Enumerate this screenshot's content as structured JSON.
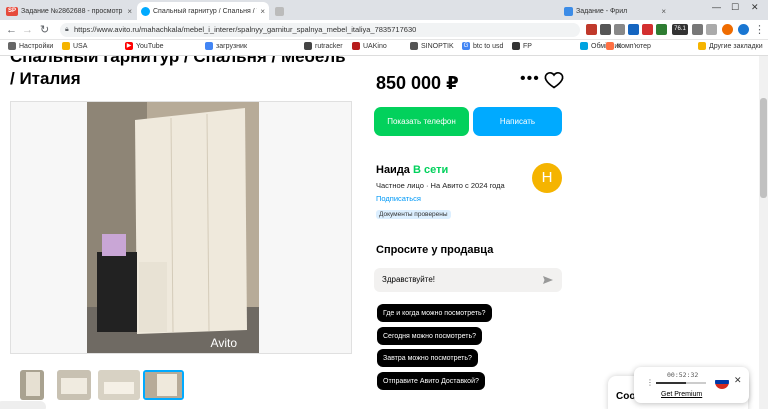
{
  "tabs": [
    {
      "title": "Задание №2862688 - просмотр з",
      "favicon": "SP",
      "color": "#e64a3b"
    },
    {
      "title": "Спальный гарнитур / Спальня / \\",
      "favicon": "",
      "color": "#00aaff"
    },
    {
      "title": "",
      "favicon": "",
      "color": "#888"
    },
    {
      "title": "",
      "favicon": "",
      "color": "#f5b400"
    },
    {
      "title": "Задание - Фрил",
      "favicon": "",
      "color": "#3c8ce7"
    }
  ],
  "url": "https://www.avito.ru/mahachkala/mebel_i_interer/spalnyy_garnitur_spalnya_mebel_italiya_7835717630",
  "bookmarks": [
    "Настройки",
    "USA",
    "YouTube",
    "загрузник",
    "rutracker",
    "UAKino",
    "SINOPTIK",
    "btc to usd",
    "FP",
    "Обмінник",
    "Комп'ютер",
    "Другие закладки"
  ],
  "listing": {
    "title": "Спальный гарнитур / Спальня / Мебель / Италия",
    "price": "850 000 ₽",
    "watermark": "Avito"
  },
  "actions": {
    "phone": "Показать телефон",
    "message": "Написать"
  },
  "seller": {
    "name": "Наида",
    "status": "В сети",
    "type": "Частное лицо · На Авито с 2024 года",
    "subscribe": "Подписаться",
    "badge": "Документы проверены",
    "avatar_letter": "Н"
  },
  "ask": {
    "title": "Спросите у продавца",
    "input_value": "Здравствуйте!",
    "questions": [
      "Где и когда можно посмотреть?",
      "Сегодня можно посмотреть?",
      "Завтра можно посмотреть?",
      "Отправите Авито Доставкой?"
    ]
  },
  "vpn": {
    "time": "00:52:32",
    "progress": 0.6,
    "premium": "Get Premium"
  },
  "cookie": {
    "text": "Coo"
  },
  "extensions": {
    "ltc_badge": "76.1"
  }
}
